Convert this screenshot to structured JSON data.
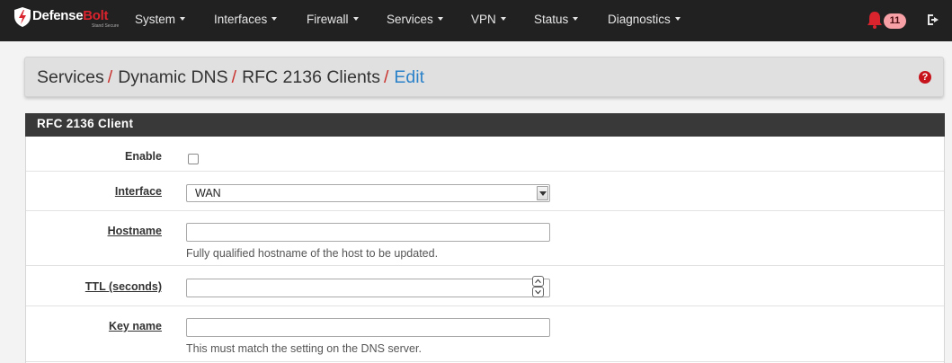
{
  "brand": {
    "name_main": "Defense",
    "name_accent": "Bolt",
    "tagline": "Stand Secure"
  },
  "nav": {
    "items": [
      {
        "label": "System"
      },
      {
        "label": "Interfaces"
      },
      {
        "label": "Firewall"
      },
      {
        "label": "Services"
      },
      {
        "label": "VPN"
      },
      {
        "label": "Status"
      },
      {
        "label": "Diagnostics"
      }
    ],
    "notification_count": "11"
  },
  "breadcrumb": {
    "items": [
      "Services",
      "Dynamic DNS",
      "RFC 2136 Clients"
    ],
    "separator": "/",
    "active": "Edit",
    "help_glyph": "?"
  },
  "panel": {
    "title": "RFC 2136 Client"
  },
  "form": {
    "enable": {
      "label": "Enable",
      "checked": false
    },
    "interface": {
      "label": "Interface",
      "value": "WAN"
    },
    "hostname": {
      "label": "Hostname",
      "value": "",
      "help": "Fully qualified hostname of the host to be updated."
    },
    "ttl": {
      "label": "TTL (seconds)",
      "value": ""
    },
    "key_name": {
      "label": "Key name",
      "value": "",
      "help": "This must match the setting on the DNS server."
    }
  },
  "colors": {
    "navbar": "#212121",
    "accent_red": "#c9302c",
    "link_blue": "#2b82c9",
    "panel_heading": "#393939"
  },
  "icons": {
    "brand": "shield-logo-icon",
    "notifications": "bell-icon",
    "logout": "sign-out-icon",
    "help": "question-circle-icon",
    "dropdown": "caret-down-icon"
  }
}
